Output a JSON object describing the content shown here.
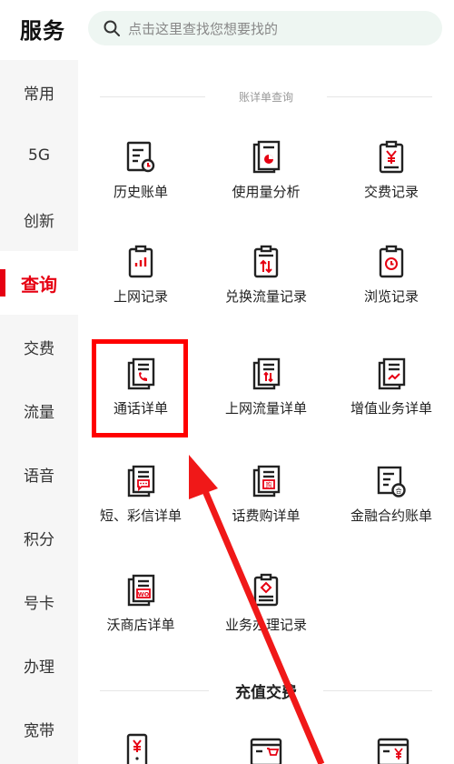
{
  "header": {
    "title": "服务",
    "search_placeholder": "点击这里查找您想要找的"
  },
  "sidebar": {
    "items": [
      {
        "label": "常用"
      },
      {
        "label": "5G"
      },
      {
        "label": "创新"
      },
      {
        "label": "查询",
        "active": true
      },
      {
        "label": "交费"
      },
      {
        "label": "流量"
      },
      {
        "label": "语音"
      },
      {
        "label": "积分"
      },
      {
        "label": "号卡"
      },
      {
        "label": "办理"
      },
      {
        "label": "宽带"
      }
    ]
  },
  "main": {
    "section1_title": "账详单查询",
    "items": [
      {
        "label": "历史账单",
        "icon": "bill-history-icon"
      },
      {
        "label": "使用量分析",
        "icon": "usage-analysis-icon"
      },
      {
        "label": "交费记录",
        "icon": "payment-record-icon"
      },
      {
        "label": "上网记录",
        "icon": "internet-record-icon"
      },
      {
        "label": "兑换流量记录",
        "icon": "data-exchange-icon"
      },
      {
        "label": "浏览记录",
        "icon": "browse-record-icon"
      },
      {
        "label": "通话详单",
        "icon": "call-detail-icon"
      },
      {
        "label": "上网流量详单",
        "icon": "data-detail-icon"
      },
      {
        "label": "增值业务详单",
        "icon": "value-added-icon"
      },
      {
        "label": "短、彩信详单",
        "icon": "sms-detail-icon"
      },
      {
        "label": "话费购详单",
        "icon": "purchase-detail-icon"
      },
      {
        "label": "金融合约账单",
        "icon": "finance-contract-icon"
      },
      {
        "label": "沃商店详单",
        "icon": "wo-store-icon"
      },
      {
        "label": "业务办理记录",
        "icon": "service-record-icon"
      }
    ],
    "section2_title": "充值交费",
    "bottom_icons": [
      "phone-recharge-icon",
      "card-cart-icon",
      "card-yen-icon"
    ]
  },
  "colors": {
    "accent": "#e60012",
    "highlight": "#ff0000",
    "search_bg": "#eef6f2"
  }
}
